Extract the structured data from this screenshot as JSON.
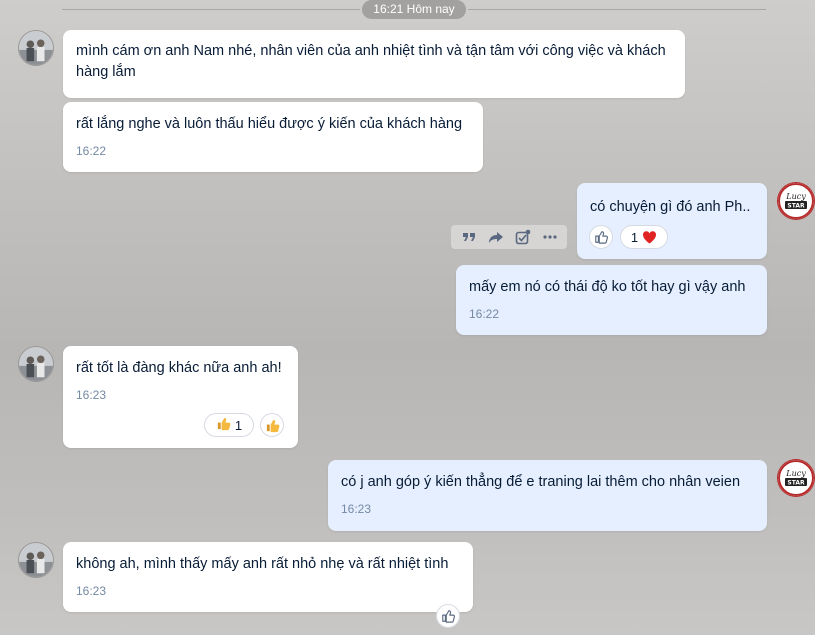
{
  "date_divider": "16:21 Hôm nay",
  "messages": [
    {
      "text": "mình cám ơn anh Nam nhé, nhân viên của anh nhiệt tình và tận tâm với công việc và khách hàng lắm"
    },
    {
      "text": "rất lắng nghe và luôn thấu hiểu được ý kiến của khách hàng",
      "time": "16:22"
    },
    {
      "text": "có  chuyện gì đó anh Ph..",
      "reaction_count": "1"
    },
    {
      "text": "mấy em nó có thái độ ko tốt hay gì vậy anh",
      "time": "16:22"
    },
    {
      "text": "rất tốt là đàng khác nữa anh ah!",
      "time": "16:23",
      "reaction_count": "1"
    },
    {
      "text": "có j anh góp ý kiến thẳng để e traning lai thêm cho nhân veien",
      "time": "16:23"
    },
    {
      "text": "không ah, mình thấy mấy anh rất nhỏ nhẹ và rất nhiệt tình",
      "time": "16:23"
    }
  ],
  "brand_avatar": {
    "line1": "Lucy",
    "line2": "STAR"
  },
  "colors": {
    "incoming": "#ffffff",
    "outgoing": "#e5efff",
    "time": "#7589a3",
    "heart": "#e02424",
    "brand": "#b52a2a"
  },
  "icons": [
    "quote-icon",
    "share-icon",
    "select-icon",
    "more-icon",
    "like-icon",
    "heart-icon",
    "thumbs-up-emoji-icon"
  ]
}
